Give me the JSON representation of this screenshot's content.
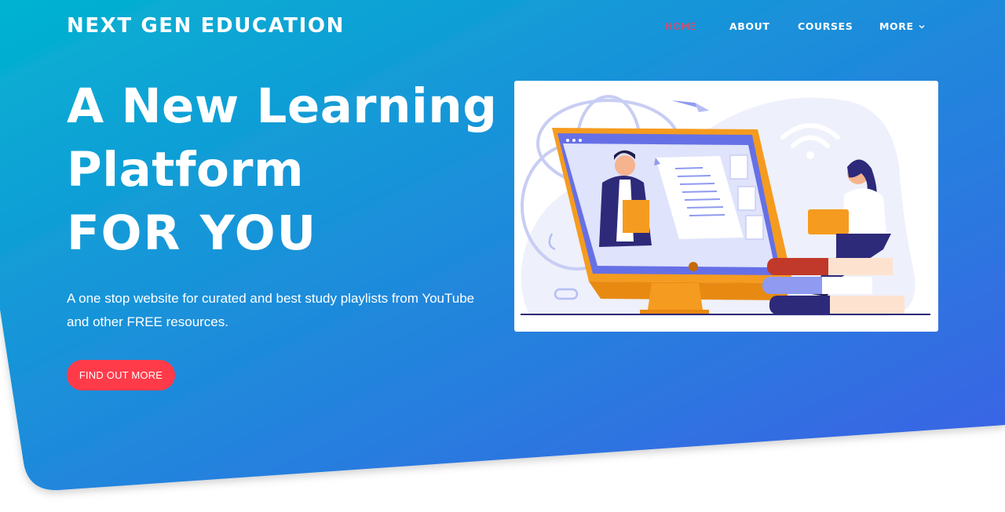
{
  "colors": {
    "gradient_start": "#02b3d1",
    "gradient_end": "#3d5fe6",
    "accent": "#ff3b4a",
    "nav_active": "#ff3c54",
    "text": "#ffffff"
  },
  "nav": {
    "brand": "NEXT GEN EDUCATION",
    "links": [
      {
        "label": "HOME",
        "active": true
      },
      {
        "label": "ABOUT",
        "active": false
      },
      {
        "label": "COURSES",
        "active": false
      },
      {
        "label": "MORE",
        "active": false,
        "icon": "chevron-down-icon"
      }
    ]
  },
  "hero": {
    "headline_line1": "A New Learning",
    "headline_line2": "Platform",
    "headline_line3": "FOR YOU",
    "subtitle": "A one stop website for curated and best study playlists from YouTube and other FREE resources.",
    "cta_label": "FIND OUT MORE",
    "illustration": "online-learning-illustration"
  }
}
